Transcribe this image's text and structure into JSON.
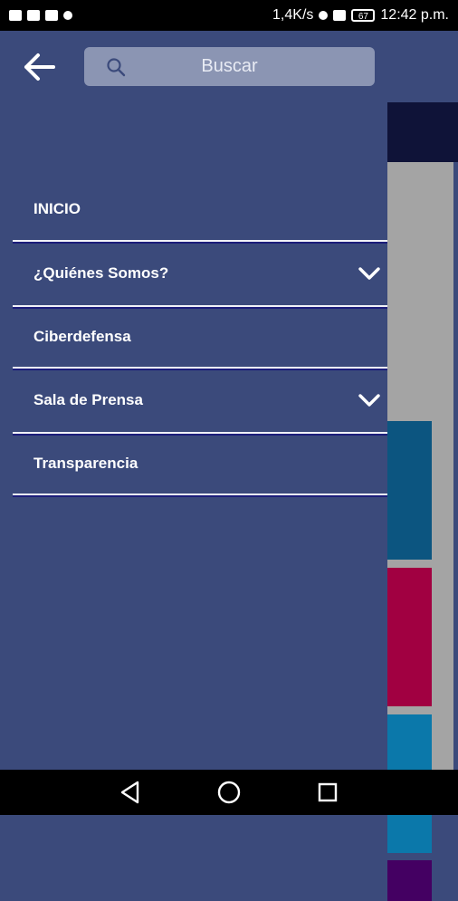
{
  "status_bar": {
    "network_speed": "1,4K/s",
    "battery": "67",
    "time": "12:42 p.m."
  },
  "search": {
    "placeholder": "Buscar"
  },
  "menu": {
    "items": [
      {
        "label": "INICIO",
        "expandable": false
      },
      {
        "label": "¿Quiénes Somos?",
        "expandable": true
      },
      {
        "label": "Ciberdefensa",
        "expandable": false
      },
      {
        "label": "Sala de Prensa",
        "expandable": true
      },
      {
        "label": "Transparencia",
        "expandable": false
      }
    ]
  },
  "colors": {
    "drawer_bg": "#3b4a7b",
    "search_bg": "#8b95b3",
    "divider": "#f1f2f8"
  },
  "icons": {
    "back": "arrow-left-icon",
    "search": "search-icon",
    "expand": "chevron-down-icon"
  }
}
